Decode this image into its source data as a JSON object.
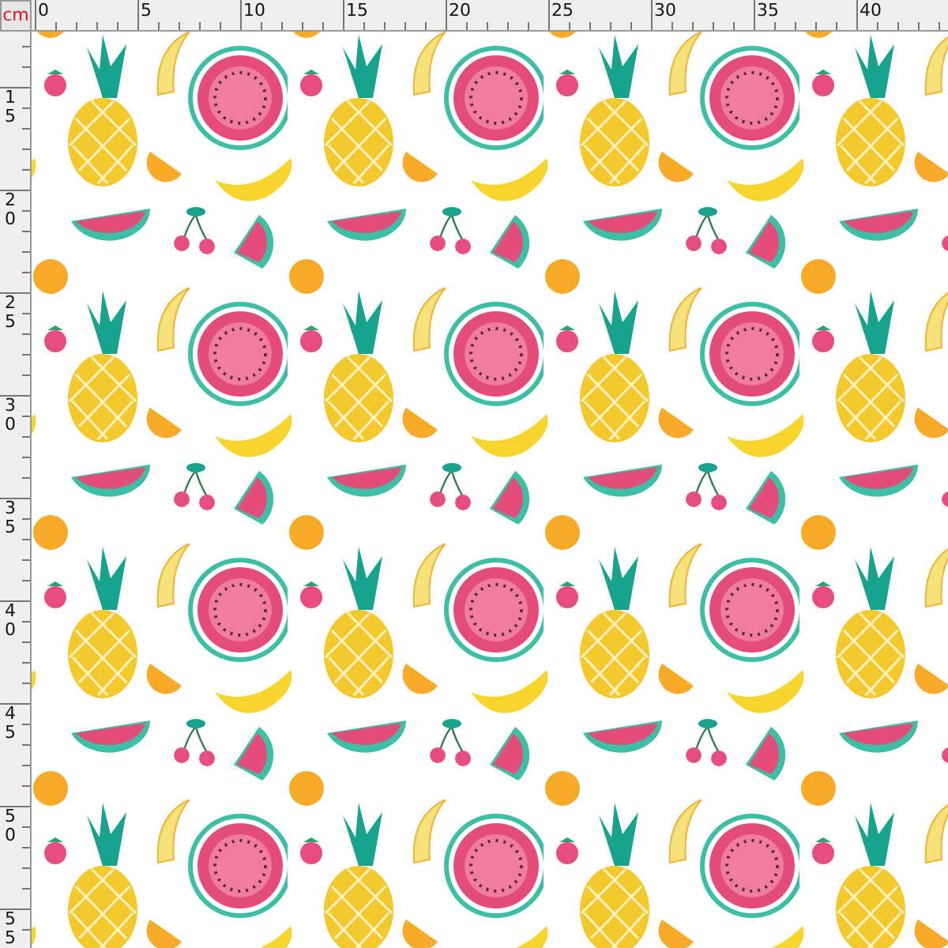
{
  "ruler": {
    "unit": "cm",
    "horizontal_labels": [
      "0",
      "5",
      "10",
      "15",
      "20",
      "25",
      "30",
      "35",
      "40"
    ],
    "vertical_labels": [
      "15",
      "20",
      "25",
      "30",
      "35",
      "40",
      "45",
      "50",
      "55"
    ]
  }
}
